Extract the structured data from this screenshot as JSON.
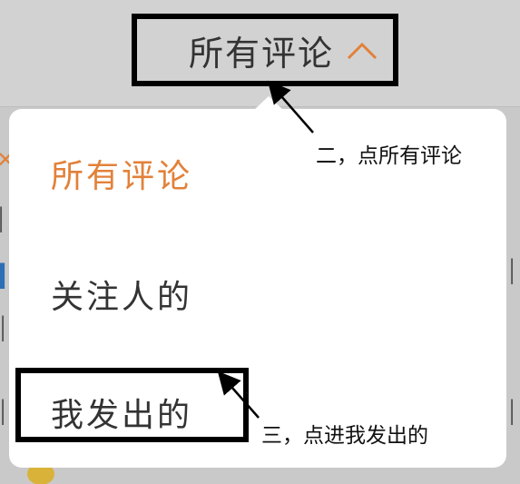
{
  "header": {
    "filter_label": "所有评论",
    "chevron_icon": "chevron-up-icon"
  },
  "dropdown": {
    "options": [
      {
        "label": "所有评论",
        "active": true
      },
      {
        "label": "关注人的",
        "active": false
      },
      {
        "label": "我发出的",
        "active": false
      }
    ]
  },
  "annotations": {
    "step2": "二，点所有评论",
    "step3": "三，点进我发出的"
  },
  "colors": {
    "accent": "#e2813a",
    "background": "#c9c9c9",
    "popover": "#ffffff"
  }
}
